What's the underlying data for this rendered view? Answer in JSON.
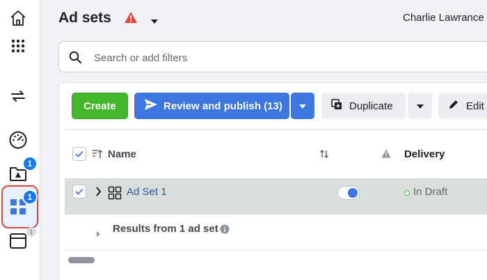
{
  "header": {
    "title": "Ad sets",
    "account_name": "Charlie Lawrance"
  },
  "search": {
    "placeholder": "Search or add filters"
  },
  "sidebar": {
    "items": [
      {
        "icon": "home-icon"
      },
      {
        "icon": "apps-grid-icon"
      },
      {
        "icon": "switch-arrows-icon"
      },
      {
        "icon": "gauge-icon"
      },
      {
        "icon": "campaign-folder-icon",
        "badge": "1"
      },
      {
        "icon": "ad-sets-icon",
        "badge": "1",
        "active": true
      },
      {
        "icon": "ads-icon",
        "badge": "1"
      }
    ]
  },
  "toolbar": {
    "create_label": "Create",
    "publish_label": "Review and publish (13)",
    "duplicate_label": "Duplicate",
    "edit_label": "Edit"
  },
  "table": {
    "columns": [
      "Name",
      "Delivery"
    ],
    "rows": [
      {
        "name": "Ad Set 1",
        "toggle_on": true,
        "delivery": "In Draft",
        "selected": true
      }
    ],
    "results_label": "Results from 1 ad set"
  },
  "colors": {
    "accent": "#3b76e1",
    "create_green": "#42b72a",
    "warning_red": "#e0453a",
    "selected_row": "#d8dfdb"
  }
}
